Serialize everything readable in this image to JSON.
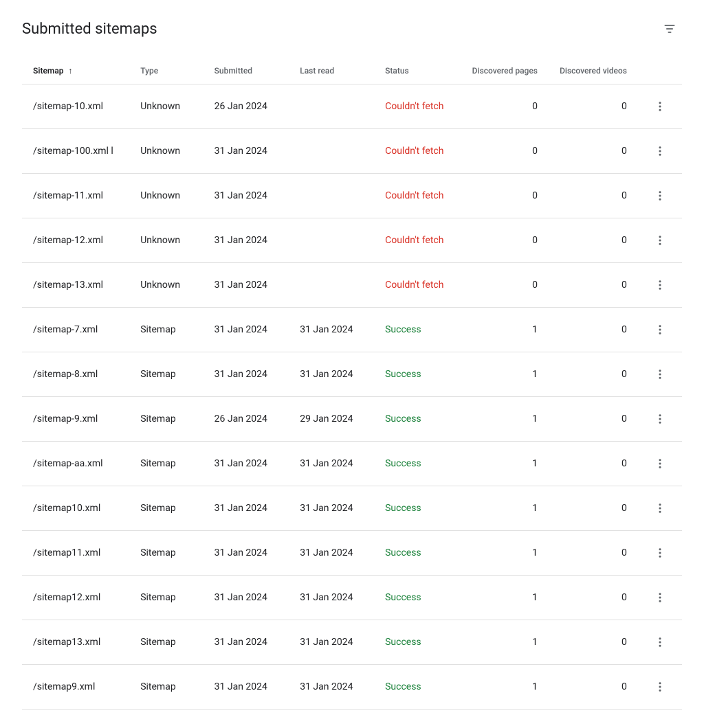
{
  "header": {
    "title": "Submitted sitemaps",
    "filter_tooltip": "Filter"
  },
  "table": {
    "columns": [
      {
        "key": "sitemap",
        "label": "Sitemap",
        "sortable": true,
        "sort_direction": "asc"
      },
      {
        "key": "type",
        "label": "Type",
        "sortable": false
      },
      {
        "key": "submitted",
        "label": "Submitted",
        "sortable": false
      },
      {
        "key": "lastread",
        "label": "Last read",
        "sortable": false
      },
      {
        "key": "status",
        "label": "Status",
        "sortable": false
      },
      {
        "key": "discovered_pages",
        "label": "Discovered pages",
        "sortable": false
      },
      {
        "key": "discovered_videos",
        "label": "Discovered videos",
        "sortable": false
      }
    ],
    "rows": [
      {
        "sitemap": "/sitemap-10.xml",
        "type": "Unknown",
        "submitted": "26 Jan 2024",
        "lastread": "",
        "status": "Couldn't fetch",
        "status_type": "error",
        "discovered_pages": "0",
        "discovered_videos": "0"
      },
      {
        "sitemap": "/sitemap-100.xml l",
        "type": "Unknown",
        "submitted": "31 Jan 2024",
        "lastread": "",
        "status": "Couldn't fetch",
        "status_type": "error",
        "discovered_pages": "0",
        "discovered_videos": "0"
      },
      {
        "sitemap": "/sitemap-11.xml",
        "type": "Unknown",
        "submitted": "31 Jan 2024",
        "lastread": "",
        "status": "Couldn't fetch",
        "status_type": "error",
        "discovered_pages": "0",
        "discovered_videos": "0"
      },
      {
        "sitemap": "/sitemap-12.xml",
        "type": "Unknown",
        "submitted": "31 Jan 2024",
        "lastread": "",
        "status": "Couldn't fetch",
        "status_type": "error",
        "discovered_pages": "0",
        "discovered_videos": "0"
      },
      {
        "sitemap": "/sitemap-13.xml",
        "type": "Unknown",
        "submitted": "31 Jan 2024",
        "lastread": "",
        "status": "Couldn't fetch",
        "status_type": "error",
        "discovered_pages": "0",
        "discovered_videos": "0"
      },
      {
        "sitemap": "/sitemap-7.xml",
        "type": "Sitemap",
        "submitted": "31 Jan 2024",
        "lastread": "31 Jan 2024",
        "status": "Success",
        "status_type": "success",
        "discovered_pages": "1",
        "discovered_videos": "0"
      },
      {
        "sitemap": "/sitemap-8.xml",
        "type": "Sitemap",
        "submitted": "31 Jan 2024",
        "lastread": "31 Jan 2024",
        "status": "Success",
        "status_type": "success",
        "discovered_pages": "1",
        "discovered_videos": "0"
      },
      {
        "sitemap": "/sitemap-9.xml",
        "type": "Sitemap",
        "submitted": "26 Jan 2024",
        "lastread": "29 Jan 2024",
        "status": "Success",
        "status_type": "success",
        "discovered_pages": "1",
        "discovered_videos": "0"
      },
      {
        "sitemap": "/sitemap-aa.xml",
        "type": "Sitemap",
        "submitted": "31 Jan 2024",
        "lastread": "31 Jan 2024",
        "status": "Success",
        "status_type": "success",
        "discovered_pages": "1",
        "discovered_videos": "0"
      },
      {
        "sitemap": "/sitemap10.xml",
        "type": "Sitemap",
        "submitted": "31 Jan 2024",
        "lastread": "31 Jan 2024",
        "status": "Success",
        "status_type": "success",
        "discovered_pages": "1",
        "discovered_videos": "0"
      },
      {
        "sitemap": "/sitemap11.xml",
        "type": "Sitemap",
        "submitted": "31 Jan 2024",
        "lastread": "31 Jan 2024",
        "status": "Success",
        "status_type": "success",
        "discovered_pages": "1",
        "discovered_videos": "0"
      },
      {
        "sitemap": "/sitemap12.xml",
        "type": "Sitemap",
        "submitted": "31 Jan 2024",
        "lastread": "31 Jan 2024",
        "status": "Success",
        "status_type": "success",
        "discovered_pages": "1",
        "discovered_videos": "0"
      },
      {
        "sitemap": "/sitemap13.xml",
        "type": "Sitemap",
        "submitted": "31 Jan 2024",
        "lastread": "31 Jan 2024",
        "status": "Success",
        "status_type": "success",
        "discovered_pages": "1",
        "discovered_videos": "0"
      },
      {
        "sitemap": "/sitemap9.xml",
        "type": "Sitemap",
        "submitted": "31 Jan 2024",
        "lastread": "31 Jan 2024",
        "status": "Success",
        "status_type": "success",
        "discovered_pages": "1",
        "discovered_videos": "0"
      }
    ]
  }
}
